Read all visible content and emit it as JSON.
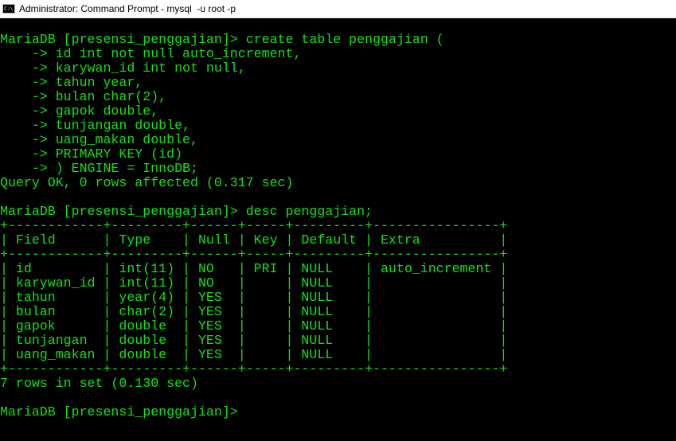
{
  "window": {
    "title": "Administrator: Command Prompt - mysql  -u root -p",
    "icon": "command-prompt-icon",
    "icon_glyph": "C:\\"
  },
  "colors": {
    "console_text": "#13e113",
    "console_bg": "#000000",
    "titlebar_bg": "#ffffff"
  },
  "console": {
    "lines": [
      "MariaDB [presensi_penggajian]> create table penggajian (",
      "    -> id int not null auto_increment,",
      "    -> karywan_id int not null,",
      "    -> tahun year,",
      "    -> bulan char(2),",
      "    -> gapok double,",
      "    -> tunjangan double,",
      "    -> uang_makan double,",
      "    -> PRIMARY KEY (id)",
      "    -> ) ENGINE = InnoDB;",
      "Query OK, 0 rows affected (0.317 sec)",
      "",
      "MariaDB [presensi_penggajian]> desc penggajian;",
      "+------------+---------+------+-----+---------+----------------+",
      "| Field      | Type    | Null | Key | Default | Extra          |",
      "+------------+---------+------+-----+---------+----------------+",
      "| id         | int(11) | NO   | PRI | NULL    | auto_increment |",
      "| karywan_id | int(11) | NO   |     | NULL    |                |",
      "| tahun      | year(4) | YES  |     | NULL    |                |",
      "| bulan      | char(2) | YES  |     | NULL    |                |",
      "| gapok      | double  | YES  |     | NULL    |                |",
      "| tunjangan  | double  | YES  |     | NULL    |                |",
      "| uang_makan | double  | YES  |     | NULL    |                |",
      "+------------+---------+------+-----+---------+----------------+",
      "7 rows in set (0.130 sec)",
      "",
      "MariaDB [presensi_penggajian]>"
    ]
  }
}
